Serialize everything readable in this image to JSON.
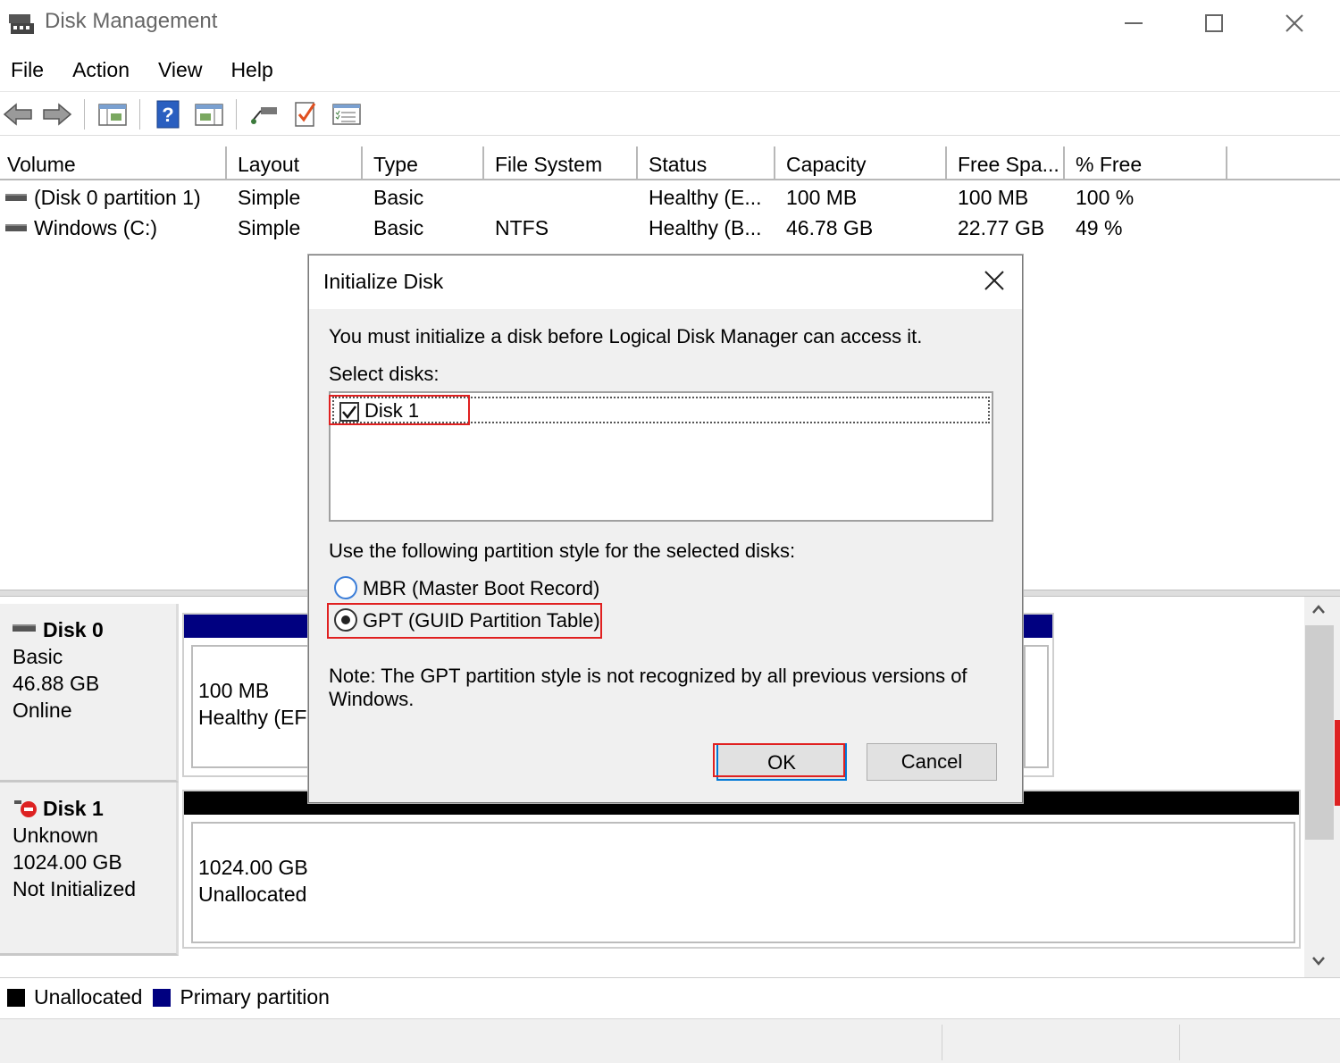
{
  "window": {
    "title": "Disk Management"
  },
  "menu": [
    "File",
    "Action",
    "View",
    "Help"
  ],
  "toolbar": {
    "icons": [
      "back-arrow-icon",
      "forward-arrow-icon",
      "console-tree-icon",
      "help-icon",
      "show-hide-icon",
      "connect-icon",
      "properties-check-icon",
      "settings-list-icon"
    ]
  },
  "volume_table": {
    "columns": [
      "Volume",
      "Layout",
      "Type",
      "File System",
      "Status",
      "Capacity",
      "Free Spa...",
      "% Free"
    ],
    "rows": [
      [
        "(Disk 0 partition 1)",
        "Simple",
        "Basic",
        "",
        "Healthy (E...",
        "100 MB",
        "100 MB",
        "100 %"
      ],
      [
        "Windows (C:)",
        "Simple",
        "Basic",
        "NTFS",
        "Healthy (B...",
        "46.78 GB",
        "22.77 GB",
        "49 %"
      ]
    ]
  },
  "disks": [
    {
      "name": "Disk 0",
      "type": "Basic",
      "size": "46.88 GB",
      "state": "Online",
      "partition": {
        "size": "100 MB",
        "status": "Healthy (EFI"
      }
    },
    {
      "name": "Disk 1",
      "type": "Unknown",
      "size": "1024.00 GB",
      "state": "Not Initialized",
      "partition": {
        "size": "1024.00 GB",
        "status": "Unallocated"
      }
    }
  ],
  "legend": [
    {
      "label": "Unallocated",
      "color": "#000000"
    },
    {
      "label": "Primary partition",
      "color": "#000080"
    }
  ],
  "dialog": {
    "title": "Initialize Disk",
    "message": "You must initialize a disk before Logical Disk Manager can access it.",
    "select_label": "Select disks:",
    "disk_items": [
      {
        "label": "Disk 1",
        "checked": true
      }
    ],
    "partition_label": "Use the following partition style for the selected disks:",
    "options": [
      {
        "label": "MBR (Master Boot Record)",
        "selected": false
      },
      {
        "label": "GPT (GUID Partition Table)",
        "selected": true
      }
    ],
    "note_line1": "Note: The GPT partition style is not recognized by all previous versions of",
    "note_line2": "Windows.",
    "ok_label": "OK",
    "cancel_label": "Cancel"
  },
  "colors": {
    "primary_partition": "#000080",
    "unallocated": "#000000",
    "highlight": "#e02020",
    "focus_blue": "#0078d7"
  }
}
